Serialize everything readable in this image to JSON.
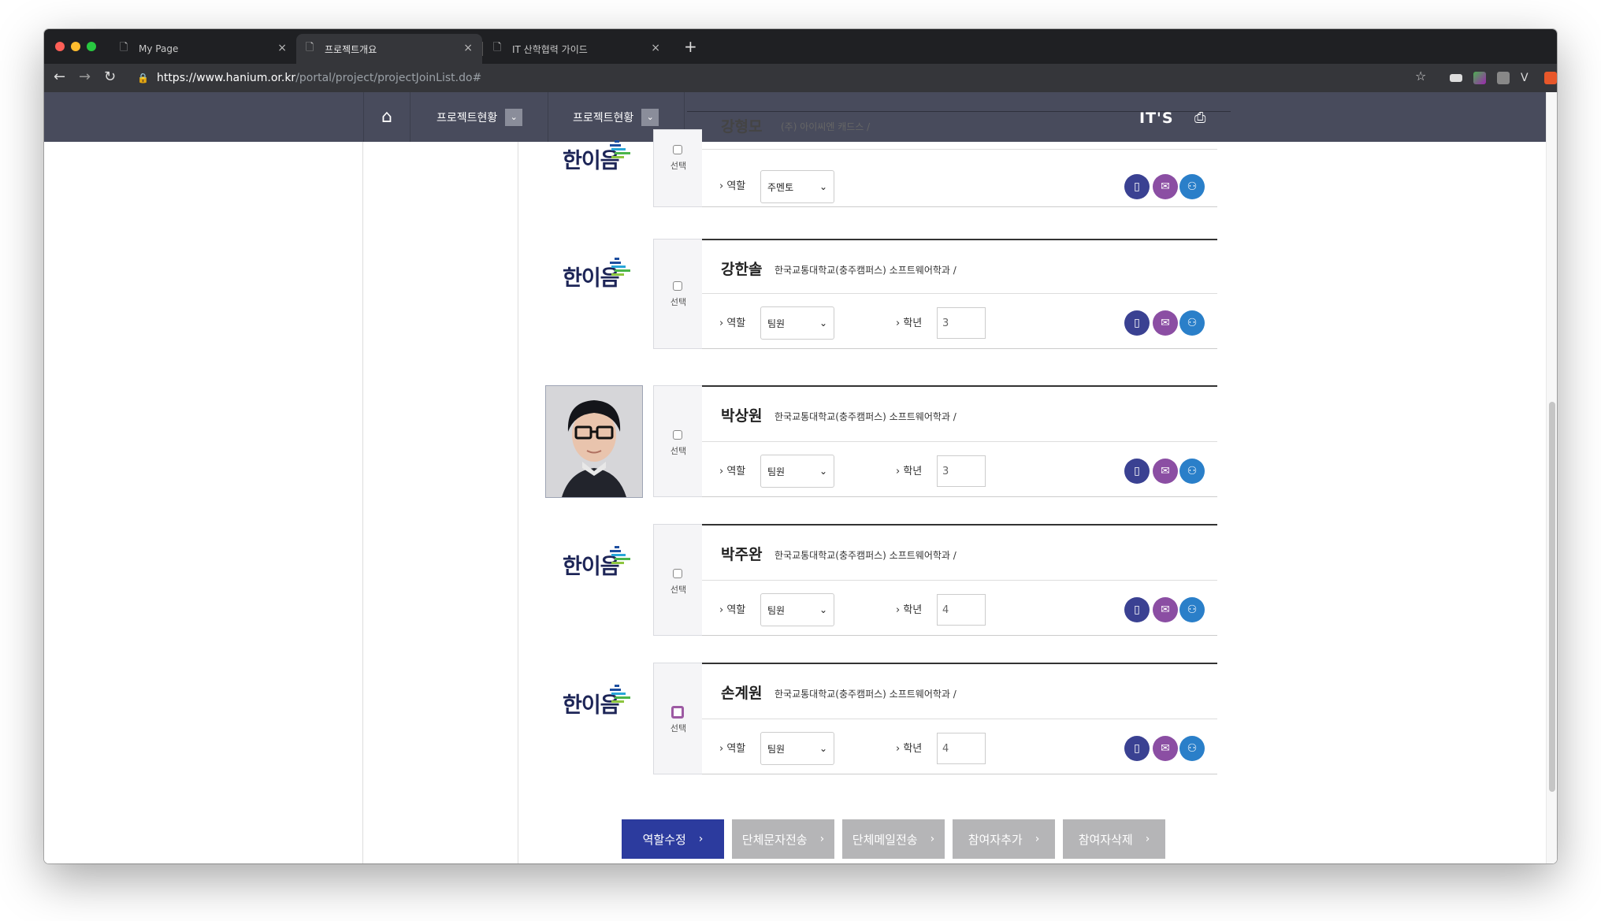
{
  "browser": {
    "tabs": [
      {
        "label": "My Page",
        "active": false
      },
      {
        "label": "프로젝트개요",
        "active": true
      },
      {
        "label": "IT 산학협력 가이드",
        "active": false
      }
    ],
    "new_tab": "+",
    "url_host": "https://www.hanium.or.kr",
    "url_path": "/portal/project/projectJoinList.do#"
  },
  "header": {
    "menu1": "프로젝트현황",
    "menu2": "프로젝트현황",
    "brand": "IT'S",
    "home_icon": "home-icon",
    "printer_icon": "printer-icon"
  },
  "logo_text": "한이음",
  "members": [
    {
      "name": "강형모",
      "school": "(주) 아이씨엔 캐드스 /",
      "role": "주멘토",
      "grade": null,
      "checkbox_focus": false,
      "photo": false
    },
    {
      "name": "강한솔",
      "school": "한국교통대학교(충주캠퍼스) 소프트웨어학과 /",
      "role": "팀원",
      "grade": "3",
      "checkbox_focus": false,
      "photo": false
    },
    {
      "name": "박상원",
      "school": "한국교통대학교(충주캠퍼스) 소프트웨어학과 /",
      "role": "팀원",
      "grade": "3",
      "checkbox_focus": false,
      "photo": true
    },
    {
      "name": "박주완",
      "school": "한국교통대학교(충주캠퍼스) 소프트웨어학과 /",
      "role": "팀원",
      "grade": "4",
      "checkbox_focus": false,
      "photo": false
    },
    {
      "name": "손계원",
      "school": "한국교통대학교(충주캠퍼스) 소프트웨어학과 /",
      "role": "팀원",
      "grade": "4",
      "checkbox_focus": true,
      "photo": false
    }
  ],
  "labels": {
    "select": "선택",
    "role": "역할",
    "grade": "학년"
  },
  "actions": [
    {
      "label": "역할수정",
      "primary": true
    },
    {
      "label": "단체문자전송",
      "primary": false
    },
    {
      "label": "단체메일전송",
      "primary": false
    },
    {
      "label": "참여자추가",
      "primary": false
    },
    {
      "label": "참여자삭제",
      "primary": false
    }
  ],
  "colors": {
    "header_bg": "#484b5c",
    "primary_btn": "#2c3b9e",
    "secondary_btn": "#b5b5b7",
    "phone_icon": "#3a4192",
    "mail_icon": "#8b4ea3",
    "profile_icon": "#2a7fc9"
  }
}
